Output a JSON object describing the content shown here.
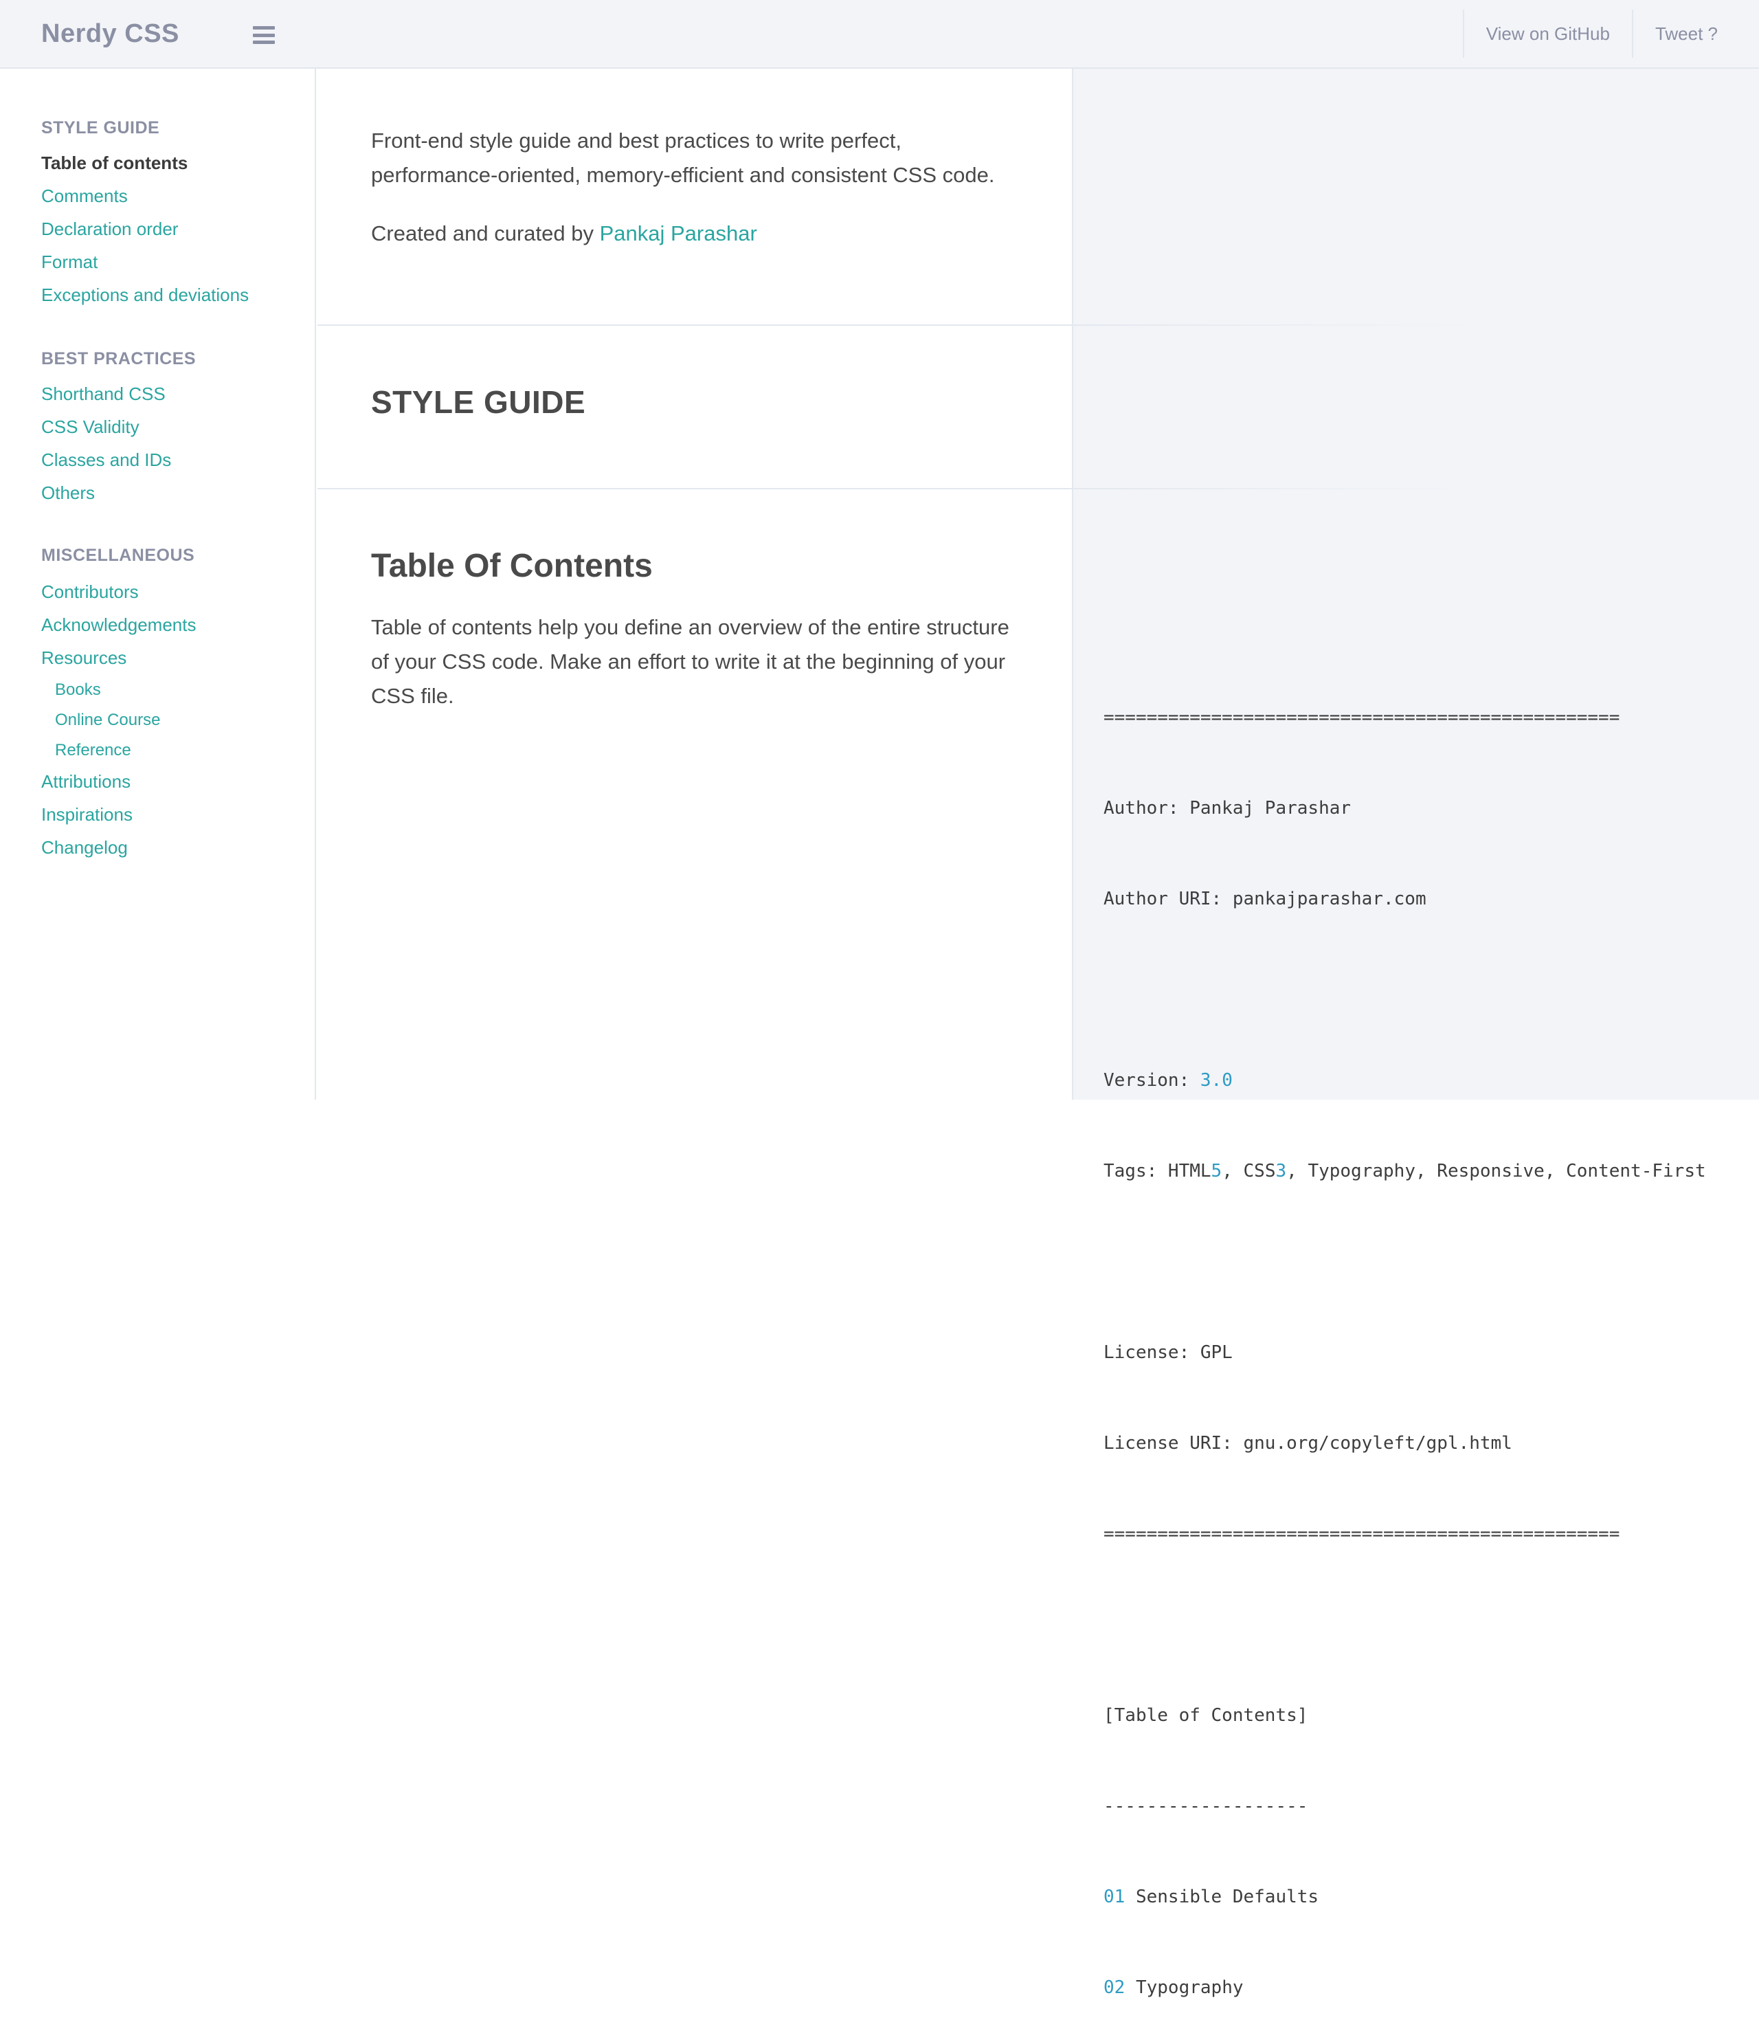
{
  "header": {
    "brand": "Nerdy CSS",
    "links": [
      "View on GitHub",
      "Tweet ?"
    ]
  },
  "sidebar": {
    "sections": [
      {
        "title": "STYLE GUIDE",
        "items": [
          "Table of contents",
          "Comments",
          "Declaration order",
          "Format",
          "Exceptions and deviations"
        ]
      },
      {
        "title": "BEST PRACTICES",
        "items": [
          "Shorthand CSS",
          "CSS Validity",
          "Classes and IDs",
          "Others"
        ]
      },
      {
        "title": "MISCELLANEOUS",
        "items": [
          "Contributors",
          "Acknowledgements",
          "Resources",
          "Books",
          "Online Course",
          "Reference",
          "Attributions",
          "Inspirations",
          "Changelog"
        ]
      }
    ]
  },
  "main": {
    "intro": "Front-end style guide and best practices to write perfect, performance-oriented, memory-efficient and consistent CSS code.",
    "credit_prefix": "Created and curated by ",
    "credit_name": "Pankaj Parashar",
    "section_heading": "STYLE GUIDE",
    "toc_title": "Table Of Contents",
    "toc_desc": "Table of contents help you define an overview of the entire structure of your CSS code. Make an effort to write it at the beginning of your CSS file."
  },
  "code": {
    "rule": "================================================",
    "author": "Author: Pankaj Parashar",
    "author_uri": "Author URI: pankajparashar.com",
    "version_label": "Version: ",
    "version_value": "3.0",
    "tags_1": "Tags: HTML",
    "tags_5": "5",
    "tags_2": ", CSS",
    "tags_3": "3",
    "tags_rest": ", Typography, Responsive, Content-First",
    "license": "License: GPL",
    "license_uri": "License URI: gnu.org/copyleft/gpl.html",
    "toc_label": "[Table of Contents]",
    "toc_rule": "-------------------",
    "toc_items": [
      {
        "num": "01",
        "label": " Sensible Defaults"
      },
      {
        "num": "02",
        "label": " Typography"
      }
    ]
  },
  "colors": {
    "accent": "#2aa5a0",
    "code_number": "#2e9bc4",
    "muted": "#8b8fa3"
  }
}
